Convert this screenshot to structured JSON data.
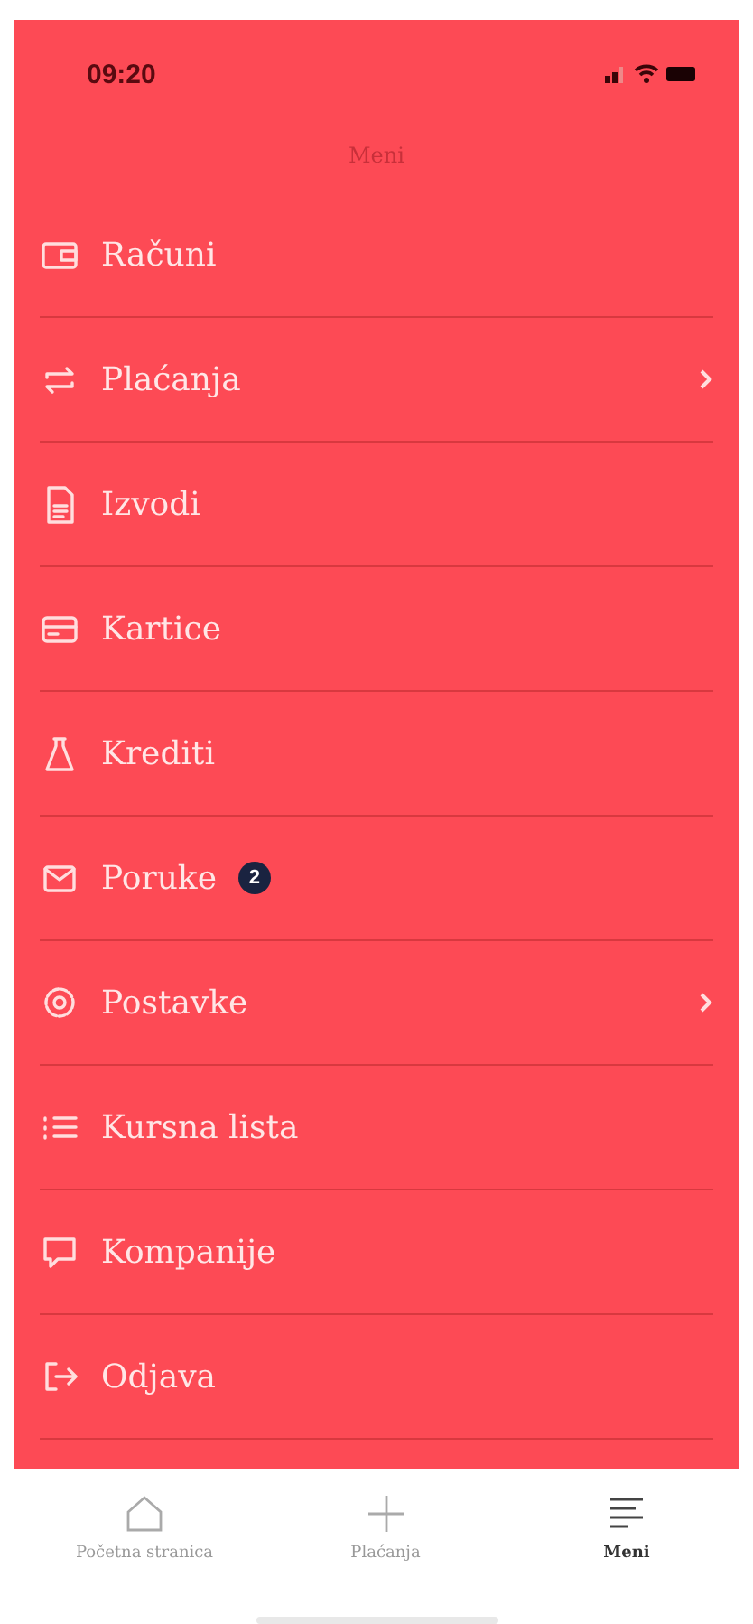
{
  "status_bar": {
    "time": "09:20"
  },
  "header": {
    "title": "Meni"
  },
  "menu": [
    {
      "label": "Računi",
      "chevron": false
    },
    {
      "label": "Plaćanja",
      "chevron": true
    },
    {
      "label": "Izvodi",
      "chevron": false
    },
    {
      "label": "Kartice",
      "chevron": false
    },
    {
      "label": "Krediti",
      "chevron": false
    },
    {
      "label": "Poruke",
      "chevron": false,
      "badge": "2"
    },
    {
      "label": "Postavke",
      "chevron": true
    },
    {
      "label": "Kursna lista",
      "chevron": false
    },
    {
      "label": "Kompanije",
      "chevron": false
    },
    {
      "label": "Odjava",
      "chevron": false
    }
  ],
  "tab_bar": [
    {
      "label": "Početna stranica",
      "selected": false
    },
    {
      "label": "Plaćanja",
      "selected": false
    },
    {
      "label": "Meni",
      "selected": true
    }
  ]
}
